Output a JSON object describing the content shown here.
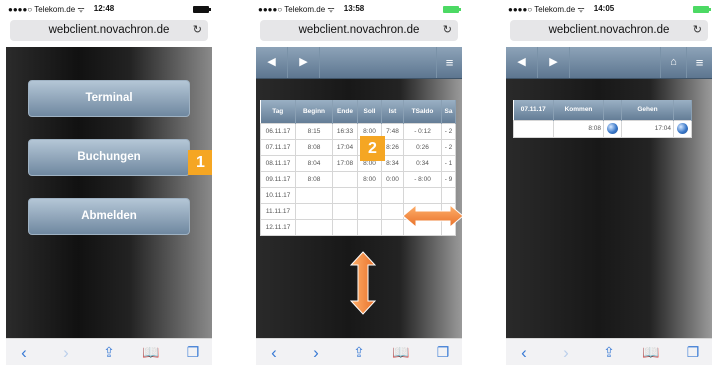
{
  "phones": [
    {
      "status": {
        "carrier": "●●●●○ Telekom.de ᯤ",
        "time": "12:48"
      },
      "url": "webclient.novachron.de",
      "buttons": [
        "Terminal",
        "Buchungen",
        "Abmelden"
      ],
      "badge": "1"
    },
    {
      "status": {
        "carrier": "●●●●○ Telekom.de ᯤ",
        "time": "13:58"
      },
      "url": "webclient.novachron.de",
      "table": {
        "headers": [
          "Tag",
          "Beginn",
          "Ende",
          "Soll",
          "Ist",
          "TSaldo",
          "Sa"
        ],
        "rows": [
          [
            "06.11.17",
            "8:15",
            "16:33",
            "8:00",
            "7:48",
            "- 0:12",
            "- 2"
          ],
          [
            "07.11.17",
            "8:08",
            "17:04",
            "",
            "8:26",
            "0:26",
            "- 2"
          ],
          [
            "08.11.17",
            "8:04",
            "17:08",
            "8:00",
            "8:34",
            "0:34",
            "- 1"
          ],
          [
            "09.11.17",
            "8:08",
            "",
            "8:00",
            "0:00",
            "- 8:00",
            "- 9"
          ],
          [
            "10.11.17",
            "",
            "",
            "",
            "",
            "",
            ""
          ],
          [
            "11.11.17",
            "",
            "",
            "",
            "",
            "",
            ""
          ],
          [
            "12.11.17",
            "",
            "",
            "",
            "",
            "",
            ""
          ]
        ]
      },
      "badge": "2"
    },
    {
      "status": {
        "carrier": "●●●●○ Telekom.de ᯤ",
        "time": "14:05"
      },
      "url": "webclient.novachron.de",
      "table": {
        "headers": [
          "07.11.17",
          "Kommen",
          "",
          "Gehen",
          ""
        ],
        "row": [
          "",
          "8:08",
          "",
          "17:04",
          ""
        ]
      }
    }
  ],
  "icons": {
    "reload": "reload-icon",
    "back": "back-icon",
    "forward": "forward-icon",
    "menu": "menu-icon",
    "home": "home-icon",
    "share": "share-icon",
    "bookmarks": "bookmarks-icon",
    "tabs": "tabs-icon",
    "horizontal": "horizontal-arrow-icon",
    "vertical": "vertical-arrow-icon",
    "globe": "globe-icon"
  },
  "colors": {
    "accent": "#f5a623",
    "toolbar": "#7890a8",
    "battery_black": "#111111",
    "battery_green": "#4cd964",
    "ios_blue": "#3a7bd5"
  }
}
